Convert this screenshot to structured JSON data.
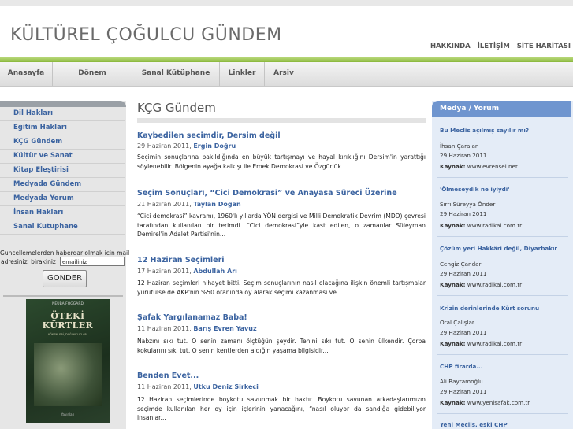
{
  "site": {
    "title": "KÜLTÜREL ÇOĞULCU GÜNDEM",
    "top_links": [
      "HAKKINDA",
      "İLETİŞİM",
      "SİTE HARİTASI"
    ]
  },
  "nav": {
    "items": [
      "Anasayfa",
      "Dönem Araştırmaları",
      "Sanal Kütüphane",
      "Linkler",
      "Arşiv"
    ]
  },
  "sidebar": {
    "items": [
      "Dil Hakları",
      "Eğitim Hakları",
      "KÇG Gündem",
      "Kültür ve Sanat",
      "Kitap Eleştirisi",
      "Medyada Gündem",
      "Medyada Yorum",
      "İnsan Hakları",
      "Sanal Kutuphane"
    ],
    "newsletter": {
      "line1": "Guncellemelerden haberdar olmak icin mail",
      "line2": "adresinizi birakiniz",
      "input_value": "emailiniz",
      "button_label": "GONDER"
    },
    "book": {
      "author": "NEUBA FOGGARD",
      "title_line1": "ÖTEKİ",
      "title_line2": "KÜRTLER",
      "subtitle": "KÖKENLERİ, DAĞINIKLIKLARI",
      "publisher": "Yayınları"
    }
  },
  "content": {
    "heading": "KÇG Gündem",
    "articles": [
      {
        "title": "Kaybedilen seçimdir, Dersim değil",
        "date": "29 Haziran 2011,",
        "author": "Ergin Doğru",
        "body": "Seçimin sonuçlarına bakıldığında en büyük tartışmayı ve hayal kırıklığını Dersim'in yarattığı söylenebilir. Bölgenin ayağa kalkışı ile Emek Demokrasi ve Özgürlük..."
      },
      {
        "title": "Seçim Sonuçları, “Cici Demokrasi” ve Anayasa Süreci Üzerine",
        "date": "21 Haziran 2011,",
        "author": "Taylan Doğan",
        "body": "“Cici demokrasi” kavramı, 1960'lı yıllarda YÖN dergisi ve Milli Demokratik Devrim (MDD) çevresi tarafından kullanılan bir terimdi. “Cici demokrasi”yle kast edilen, o zamanlar Süleyman Demirel'in Adalet Partisi'nin..."
      },
      {
        "title": "12 Haziran Seçimleri",
        "date": "17 Haziran 2011,",
        "author": "Abdullah Arı",
        "body": "12 Haziran seçimleri nihayet bitti. Seçim sonuçlarının nasıl olacağına ilişkin önemli tartışmalar yürütülse de AKP'nin %50 oranında oy alarak seçimi kazanması ve..."
      },
      {
        "title": "Şafak Yargılanamaz Baba!",
        "date": "11 Haziran 2011,",
        "author": "Barış Evren Yavuz",
        "body": "Nabzını sıkı tut. O senin zamanı ölçtüğün şeydir. Tenini sıkı tut. O senin ülkendir. Çorba kokularını sıkı tut. O senin kentlerden aldığın yaşama bilgisidir..."
      },
      {
        "title": "Benden Evet...",
        "date": "11 Haziran 2011,",
        "author": "Utku Deniz Sirkeci",
        "body": "12 Haziran seçimlerinde boykotu savunmak bir haktır. Boykotu savunan arkadaşlarımızın seçimde kullanılan her oy için içlerinin yanacağını, “nasıl oluyor da sandığa gidebiliyor insanlar..."
      }
    ]
  },
  "right": {
    "heading": "Medya / Yorum",
    "source_label": "Kaynak:",
    "items": [
      {
        "title": "Bu Meclis açılmış sayılır mı?",
        "author": "İhsan Çaralan",
        "date": "29 Haziran 2011",
        "source": "www.evrensel.net"
      },
      {
        "title": "'Ölmeseydik ne iyiydi'",
        "author": "Sırrı Süreyya Önder",
        "date": "29 Haziran 2011",
        "source": "www.radikal.com.tr"
      },
      {
        "title": "Çözüm yeri Hakkâri değil, Diyarbakır",
        "author": "Cengiz Çandar",
        "date": "29 Haziran 2011",
        "source": "www.radikal.com.tr"
      },
      {
        "title": "Krizin derinlerinde Kürt sorunu",
        "author": "Oral Çalışlar",
        "date": "29 Haziran 2011",
        "source": "www.radikal.com.tr"
      },
      {
        "title": "CHP firarda...",
        "author": "Ali Bayramoğlu",
        "date": "29 Haziran 2011",
        "source": "www.yenisafak.com.tr"
      },
      {
        "title": "Yeni Meclis, eski CHP"
      }
    ]
  },
  "colors": {
    "accent": "#3b63a0",
    "green_bar": "#8ab83c",
    "right_header": "#6f95cf"
  }
}
